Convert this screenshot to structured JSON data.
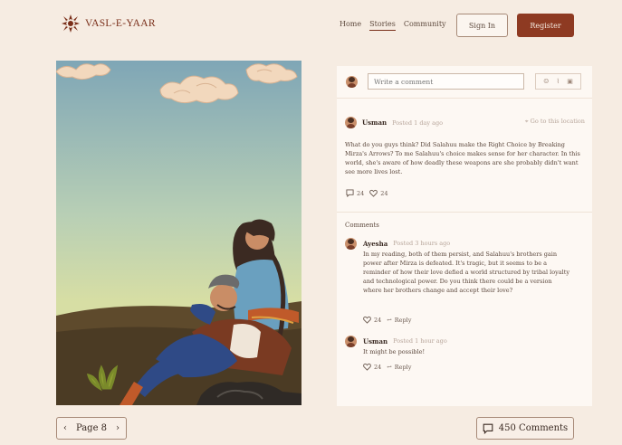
{
  "brand": {
    "name": "VASL-E-YAAR"
  },
  "nav": {
    "home": "Home",
    "stories": "Stories",
    "community": "Community"
  },
  "auth": {
    "signin": "Sign In",
    "register": "Register"
  },
  "composer": {
    "placeholder": "Write a comment"
  },
  "post": {
    "user": "Usman",
    "meta": "Posted 1 day ago",
    "go_link": "Go to this location",
    "body": "What do you guys think? Did Salahuu make the Right Choice by Breaking Mirza's Arrows? To me Salahuu's choice makes sense for her character. In this world, she's aware of how deadly these weapons are she probably didn't want see more lives lost.",
    "comments_count": "24",
    "likes_count": "24"
  },
  "comments_section": {
    "title": "Comments",
    "items": [
      {
        "user": "Ayesha",
        "meta": "Posted 3 hours ago",
        "body": "In my reading, both of them persist, and Salahuu's brothers gain power after Mirza is defeated. It's tragic, but it seems to be a reminder of how their love defied a world structured by tribal loyalty and technological power. Do you think there could be a version where her brothers change and accept their love?",
        "likes": "24",
        "reply": "Reply"
      },
      {
        "user": "Usman",
        "meta": "Posted 1 hour ago",
        "body": "It might be possible!",
        "likes": "24",
        "reply": "Reply"
      }
    ]
  },
  "pager": {
    "label": "Page 8"
  },
  "comments_button": {
    "label": "450 Comments"
  }
}
